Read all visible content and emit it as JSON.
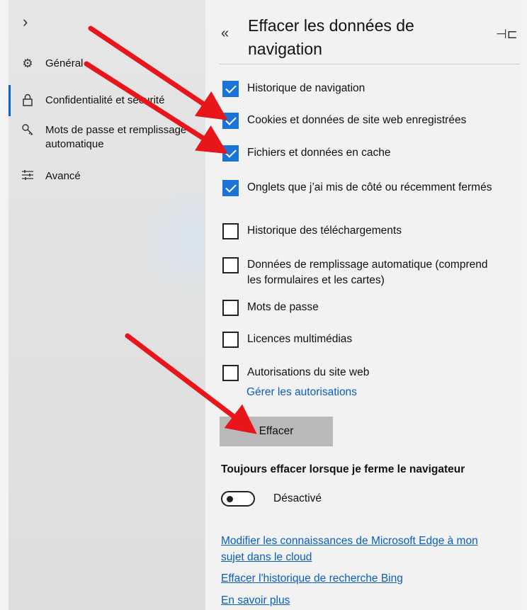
{
  "sidebar": {
    "items": [
      {
        "label": "Général",
        "icon": "gear-icon"
      },
      {
        "label": "Confidentialité et sécurité",
        "icon": "lock-icon"
      },
      {
        "label": "Mots de passe et remplissage automatique",
        "icon": "key-icon"
      },
      {
        "label": "Avancé",
        "icon": "sliders-icon"
      }
    ]
  },
  "panel": {
    "title": "Effacer les données de navigation",
    "options": [
      {
        "label": "Historique de navigation",
        "checked": true
      },
      {
        "label": "Cookies et données de site web enregistrées",
        "checked": true
      },
      {
        "label": "Fichiers et données en cache",
        "checked": true
      },
      {
        "label": "Onglets que j’ai mis de côté ou récemment fermés",
        "checked": true
      },
      {
        "label": "Historique des téléchargements",
        "checked": false
      },
      {
        "label": "Données de remplissage automatique (comprend les formulaires et les cartes)",
        "checked": false
      },
      {
        "label": "Mots de passe",
        "checked": false
      },
      {
        "label": "Licences multimédias",
        "checked": false
      },
      {
        "label": "Autorisations du site web",
        "checked": false
      }
    ],
    "manage_link": "Gérer les autorisations",
    "clear_button": "Effacer",
    "always_clear_label": "Toujours effacer lorsque je ferme le navigateur",
    "toggle_state": "Désactivé",
    "links": [
      "Modifier les connaissances de Microsoft Edge à mon sujet dans le cloud",
      "Effacer l'historique de recherche Bing",
      "En savoir plus"
    ]
  },
  "colors": {
    "accent": "#1a73d6",
    "arrow": "#e8151b"
  }
}
